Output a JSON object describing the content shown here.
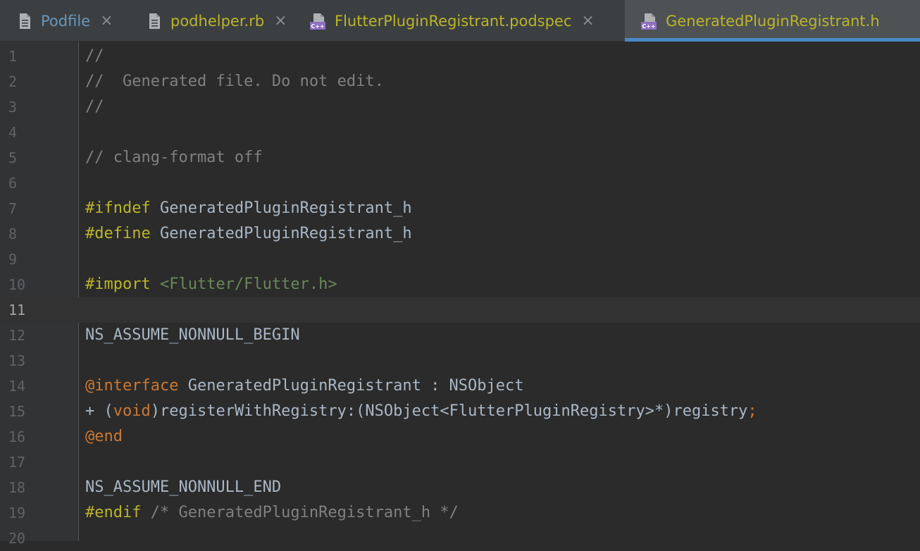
{
  "tabs": [
    {
      "label": "Podfile",
      "icon": "text-file-icon",
      "color": "#6897bb",
      "close": "×",
      "active": false
    },
    {
      "label": "podhelper.rb",
      "icon": "text-file-icon",
      "color": "#bbb529",
      "close": "×",
      "active": false
    },
    {
      "label": "FlutterPluginRegistrant.podspec",
      "icon": "cpp-file-icon",
      "color": "#bbb529",
      "close": "×",
      "active": false
    },
    {
      "label": "GeneratedPluginRegistrant.h",
      "icon": "cpp-file-icon",
      "color": "#bbb529",
      "close": "",
      "active": true
    }
  ],
  "icon_badge": "C++",
  "editor": {
    "current_line": 11,
    "lines": [
      {
        "n": "1",
        "tokens": [
          {
            "t": "//",
            "c": "comment"
          }
        ]
      },
      {
        "n": "2",
        "tokens": [
          {
            "t": "//  Generated file. Do not edit.",
            "c": "comment"
          }
        ]
      },
      {
        "n": "3",
        "tokens": [
          {
            "t": "//",
            "c": "comment"
          }
        ]
      },
      {
        "n": "4",
        "tokens": []
      },
      {
        "n": "5",
        "tokens": [
          {
            "t": "// clang-format off",
            "c": "comment"
          }
        ]
      },
      {
        "n": "6",
        "tokens": []
      },
      {
        "n": "7",
        "tokens": [
          {
            "t": "#ifndef",
            "c": "pre"
          },
          {
            "t": " GeneratedPluginRegistrant_h",
            "c": "plain"
          }
        ]
      },
      {
        "n": "8",
        "tokens": [
          {
            "t": "#define",
            "c": "pre"
          },
          {
            "t": " GeneratedPluginRegistrant_h",
            "c": "plain"
          }
        ]
      },
      {
        "n": "9",
        "tokens": []
      },
      {
        "n": "10",
        "tokens": [
          {
            "t": "#import",
            "c": "pre"
          },
          {
            "t": " ",
            "c": "plain"
          },
          {
            "t": "<Flutter/Flutter.h>",
            "c": "str"
          }
        ]
      },
      {
        "n": "11",
        "tokens": []
      },
      {
        "n": "12",
        "tokens": [
          {
            "t": "NS_ASSUME_NONNULL_BEGIN",
            "c": "plain"
          }
        ]
      },
      {
        "n": "13",
        "tokens": []
      },
      {
        "n": "14",
        "tokens": [
          {
            "t": "@interface",
            "c": "kw"
          },
          {
            "t": " GeneratedPluginRegistrant : NSObject",
            "c": "plain"
          }
        ]
      },
      {
        "n": "15",
        "tokens": [
          {
            "t": "+ (",
            "c": "plain"
          },
          {
            "t": "void",
            "c": "kw"
          },
          {
            "t": ")registerWithRegistry:(NSObject<FlutterPluginRegistry>*)registry",
            "c": "plain"
          },
          {
            "t": ";",
            "c": "kw"
          }
        ]
      },
      {
        "n": "16",
        "tokens": [
          {
            "t": "@end",
            "c": "kw"
          }
        ]
      },
      {
        "n": "17",
        "tokens": []
      },
      {
        "n": "18",
        "tokens": [
          {
            "t": "NS_ASSUME_NONNULL_END",
            "c": "plain"
          }
        ]
      },
      {
        "n": "19",
        "tokens": [
          {
            "t": "#endif",
            "c": "pre"
          },
          {
            "t": " ",
            "c": "plain"
          },
          {
            "t": "/* GeneratedPluginRegistrant_h */",
            "c": "comment"
          }
        ]
      },
      {
        "n": "20",
        "tokens": []
      }
    ]
  },
  "colors": {
    "background": "#2b2b2b",
    "gutter": "#313335",
    "tabbar": "#3c3f41",
    "active_tab_underline": "#4a88c7",
    "comment": "#808080",
    "preprocessor": "#bbb529",
    "string": "#6a8759",
    "keyword": "#cc7832",
    "plain": "#a9b7c6"
  }
}
